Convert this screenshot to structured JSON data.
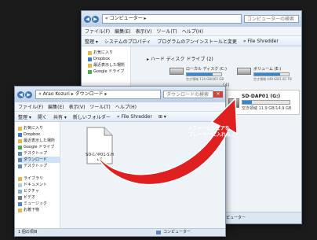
{
  "back_window": {
    "address": "« コンピューター ▸",
    "search_placeholder": "コンピューターの検索",
    "menu": [
      "ファイル(F)",
      "編集(E)",
      "表示(V)",
      "ツール(T)",
      "ヘルプ(H)"
    ],
    "toolbar": [
      "整理 ▾",
      "システムのプロパティ",
      "プログラムのアンインストールと変更",
      "» File Shredder"
    ],
    "sidebar": [
      "お気に入り",
      "Dropbox",
      "最近表示した場所",
      "Google ドライブ"
    ],
    "section_header": "▸ ハード ディスク ドライブ (2)",
    "drives": [
      {
        "name": "ローカル ディスク (C:)",
        "info": "空き領域 114 GB/465 GB",
        "fill": 0.75
      },
      {
        "name": "ボリューム (E:)",
        "info": "空き領域 449 GB/1.81 TB",
        "fill": 0.76
      },
      {
        "name": "SD-DAP01 (G:)",
        "info": "空き領域 11.9 GB/14.9 GB",
        "fill": 0.2
      }
    ],
    "status": "コンピューター",
    "partial_label": "(4)"
  },
  "front_window": {
    "address": "« Arao Kozuri ▸ ダウンロード ▸",
    "search_placeholder": "ダウンロードの検索",
    "menu": [
      "ファイル(F)",
      "編集(E)",
      "表示(V)",
      "ツール(T)",
      "ヘルプ(H)"
    ],
    "toolbar": [
      "整理 ▾",
      "開く",
      "共有 ▾",
      "新しいフォルダー",
      "» File Shredder",
      "⊞ ▾"
    ],
    "sidebar_favorites": [
      "お気に入り",
      "Dropbox",
      "最近表示した場所",
      "Google ドライブ",
      "デスクトップ",
      "ダウンロード",
      "デスクトップ"
    ],
    "sidebar_library": [
      "ライブラリ",
      "ドキュメント",
      "ピクチャ",
      "ビデオ",
      "ミュージック",
      "お着下物"
    ],
    "file_name": "SD-DAP01-S.H EX",
    "status": "1 個の項目",
    "status_right": "コンピューター"
  },
  "annotation": {
    "text_line1": "③ファームウェアを",
    "text_line2": "プレーヤーに入れる"
  },
  "colors": {
    "arrow": "#e02020",
    "highlight": "#ffffff",
    "background": "#1b1b1b"
  }
}
